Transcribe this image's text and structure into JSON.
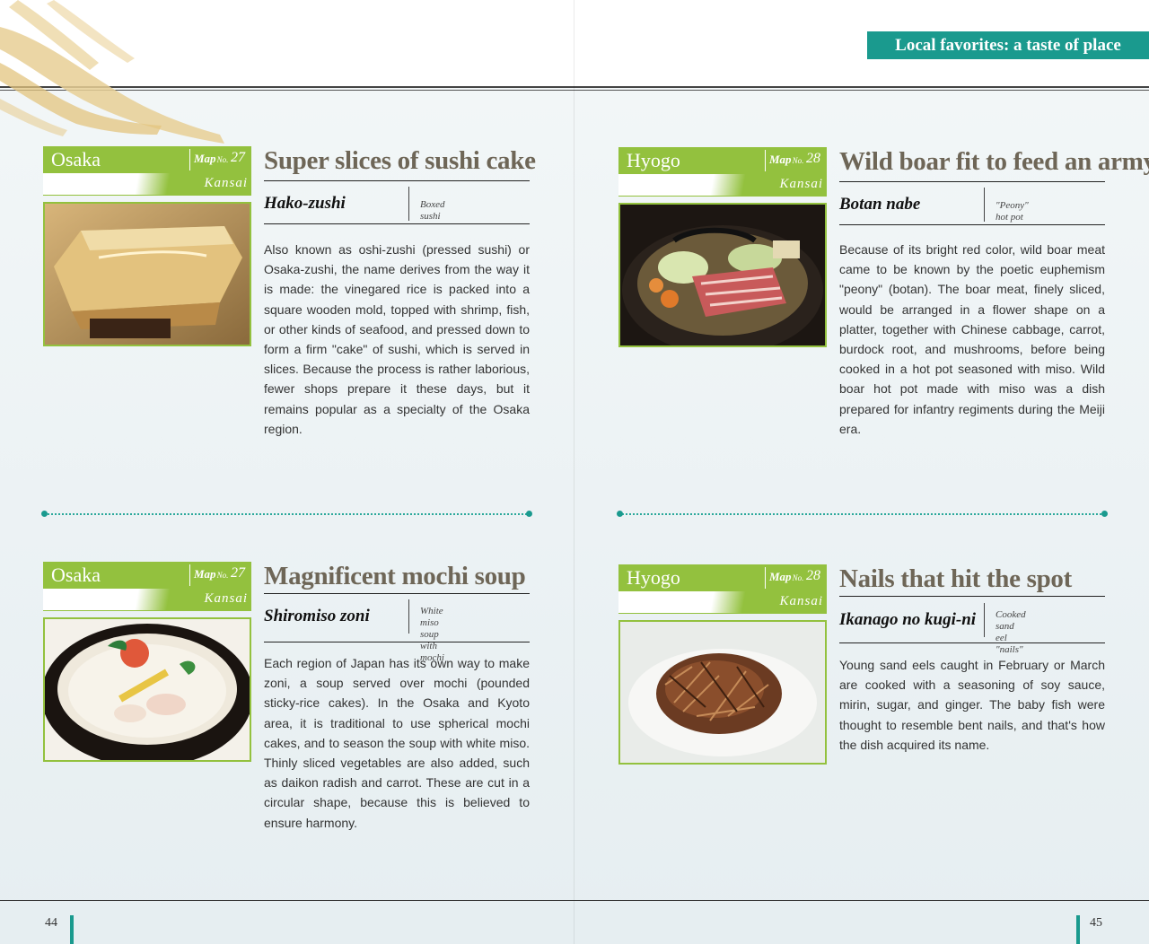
{
  "header": {
    "section_title": "Local favorites: a taste of place"
  },
  "entries": [
    {
      "prefecture": "Osaka",
      "map_label": "Map",
      "map_no_label": "No.",
      "map_number": "27",
      "region": "Kansai",
      "title": "Super slices of sushi cake",
      "japanese_name": "Hako-zushi",
      "english_name": "Boxed sushi",
      "body": "Also known as oshi-zushi (pressed sushi) or Osaka-zushi, the name derives from the way it is made: the vinegared rice is packed into a square wooden mold, topped with shrimp, fish, or other kinds of seafood, and pressed down to form a firm \"cake\" of sushi, which is served in slices. Because the process is rather laborious, fewer shops prepare it these days, but it remains popular as a specialty of the Osaka region.",
      "photo_icon": "boxed-sushi-photo"
    },
    {
      "prefecture": "Hyogo",
      "map_label": "Map",
      "map_no_label": "No.",
      "map_number": "28",
      "region": "Kansai",
      "title": "Wild boar fit to feed an army",
      "japanese_name": "Botan nabe",
      "english_name": "\"Peony\" hot pot",
      "body": "Because of its bright red color, wild boar meat came to be known by the poetic euphemism \"peony\" (botan). The boar meat, finely sliced, would be arranged in a flower shape on a platter, together with Chinese cabbage, carrot, burdock root, and mushrooms, before being cooked in a hot pot seasoned with miso. Wild boar hot pot made with miso was a dish prepared for infantry regiments during the Meiji era.",
      "photo_icon": "boar-hot-pot-photo"
    },
    {
      "prefecture": "Osaka",
      "map_label": "Map",
      "map_no_label": "No.",
      "map_number": "27",
      "region": "Kansai",
      "title": "Magnificent mochi soup",
      "japanese_name": "Shiromiso zoni",
      "english_name_line1": "White miso soup",
      "english_name_line2": "with mochi",
      "body": "Each region of Japan has its own way to make zoni, a soup served over mochi (pounded sticky-rice cakes). In the Osaka and Kyoto area, it is traditional to use spherical mochi cakes, and to season the soup with white miso. Thinly sliced vegetables are also added, such as daikon radish and carrot. These are cut in a circular shape, because this is believed to ensure harmony.",
      "photo_icon": "mochi-soup-photo"
    },
    {
      "prefecture": "Hyogo",
      "map_label": "Map",
      "map_no_label": "No.",
      "map_number": "28",
      "region": "Kansai",
      "title": "Nails that hit the spot",
      "japanese_name": "Ikanago no kugi-ni",
      "english_name_line1": "Cooked sand",
      "english_name_line2": "eel \"nails\"",
      "body": "Young sand eels caught in February or March are cooked with a seasoning of soy sauce, mirin, sugar, and ginger. The baby fish were thought to resemble bent nails, and that's how the dish acquired its name.",
      "photo_icon": "sand-eel-photo"
    }
  ],
  "footer": {
    "left_page": "44",
    "right_page": "45"
  },
  "colors": {
    "teal": "#1a9a8e",
    "green": "#93c13e",
    "title_brown": "#6e6657"
  }
}
